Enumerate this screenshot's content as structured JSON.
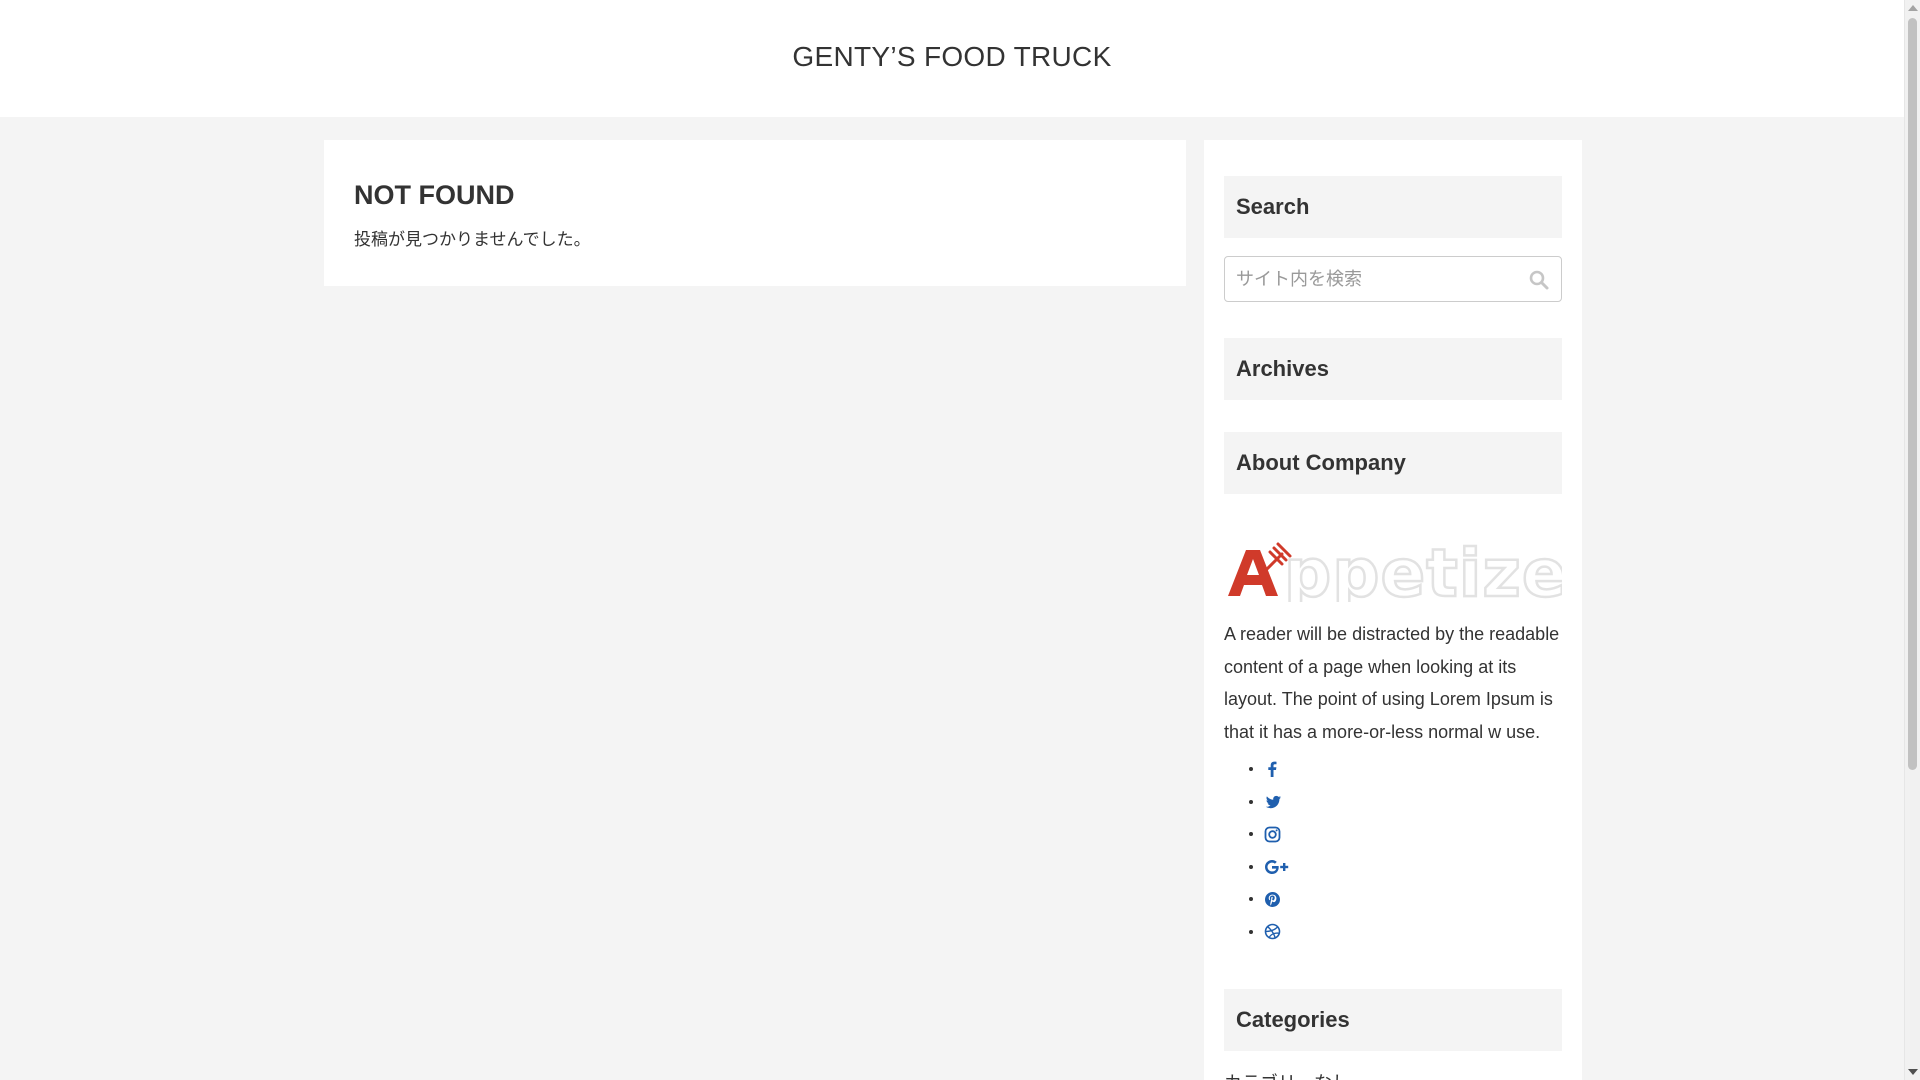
{
  "header": {
    "site_title": "GENTY’S FOOD TRUCK"
  },
  "main": {
    "heading": "NOT FOUND",
    "message": "投稿が見つかりませんでした。"
  },
  "sidebar": {
    "search": {
      "title": "Search",
      "placeholder": "サイト内を検索",
      "button_icon": "search-icon"
    },
    "archives": {
      "title": "Archives"
    },
    "about": {
      "title": "About Company",
      "logo_text": "Appetizer",
      "logo_colors": {
        "accent": "#d03a2a",
        "light": "#e9e9e9"
      },
      "description": "A reader will be distracted by the readable content of a page when looking at its layout. The point of using Lorem Ipsum is that it has a more-or-less normal w use.",
      "social": [
        {
          "name": "facebook",
          "icon": "facebook-icon"
        },
        {
          "name": "twitter",
          "icon": "twitter-icon"
        },
        {
          "name": "instagram",
          "icon": "instagram-icon"
        },
        {
          "name": "google-plus",
          "icon": "google-plus-icon"
        },
        {
          "name": "pinterest",
          "icon": "pinterest-icon"
        },
        {
          "name": "dribbble",
          "icon": "dribbble-icon"
        }
      ],
      "social_color": "#1f5fae"
    },
    "categories": {
      "title": "Categories",
      "items": [
        "カテゴリーなし"
      ]
    }
  }
}
